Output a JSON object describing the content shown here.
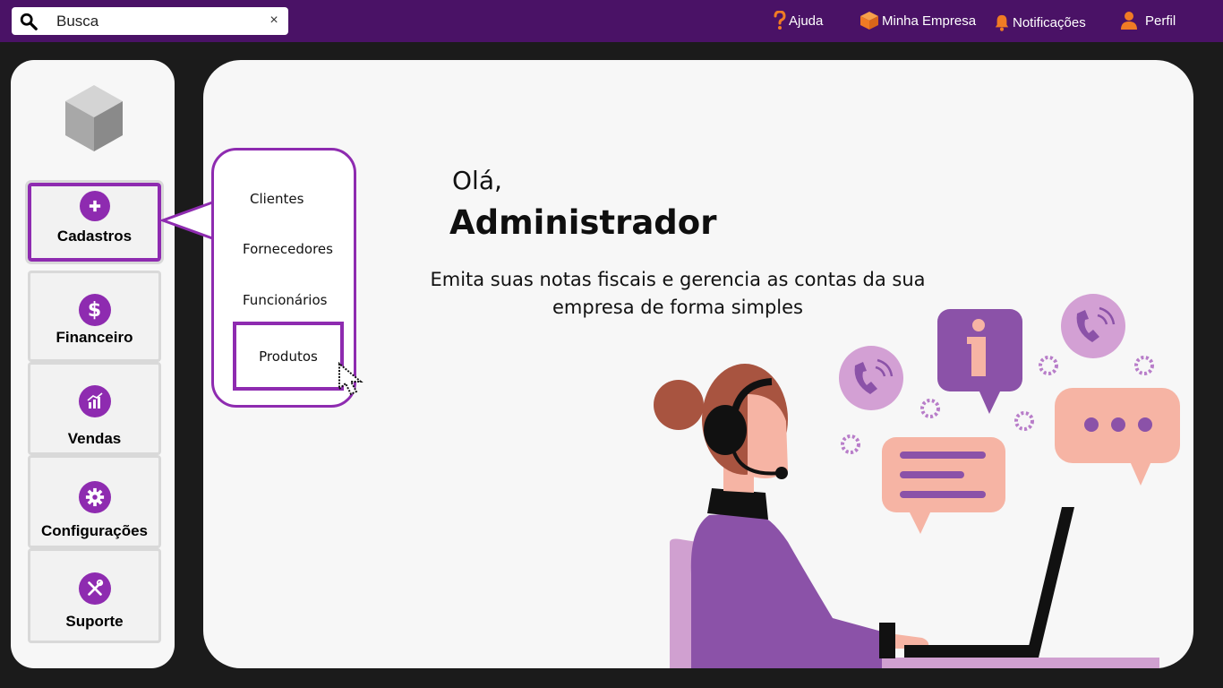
{
  "search": {
    "placeholder": "Busca",
    "clear_label": "×"
  },
  "topnav": {
    "help": "Ajuda",
    "company": "Minha Empresa",
    "notifications": "Notificações",
    "profile": "Perfil"
  },
  "sidebar": {
    "items": [
      {
        "label": "Cadastros",
        "icon": "plus-icon"
      },
      {
        "label": "Financeiro",
        "icon": "dollar-icon"
      },
      {
        "label": "Vendas",
        "icon": "chart-icon"
      },
      {
        "label": "Configurações",
        "icon": "gear-icon"
      },
      {
        "label": "Suporte",
        "icon": "tools-icon"
      }
    ]
  },
  "dropdown": {
    "items": [
      "Clientes",
      "Fornecedores",
      "Funcionários",
      "Produtos"
    ],
    "selected": "Produtos"
  },
  "main": {
    "greeting": "Olá,",
    "user": "Administrador",
    "subtitle_line1": "Emita suas notas fiscais e gerencia as contas da sua",
    "subtitle_line2": "empresa de forma simples"
  },
  "colors": {
    "topbar": "#4a1266",
    "accent": "#8e2bb0",
    "orange_icon": "#f07b24",
    "panel": "#f7f7f7",
    "background": "#1b1b1b"
  }
}
